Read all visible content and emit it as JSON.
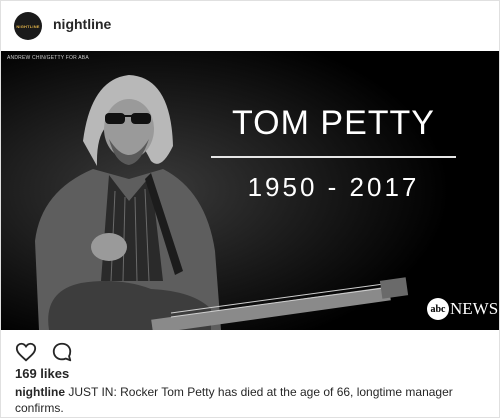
{
  "post": {
    "username": "nightline",
    "avatar_text": "NIGHTLINE",
    "likes": "169 likes",
    "caption_user": "nightline",
    "caption_text": " JUST IN: Rocker Tom Petty has died at the age of 66, longtime manager confirms."
  },
  "image": {
    "credit": "ANDREW CHIN/GETTY FOR ABA",
    "headline": "TOM PETTY",
    "years": "1950 - 2017",
    "logo_abc": "abc",
    "logo_news": "NEWS"
  },
  "icons": {
    "like": "heart-icon",
    "comment": "comment-icon"
  },
  "colors": {
    "photo_bg": "#000000",
    "text": "#262626",
    "border": "#e0e0e0"
  }
}
